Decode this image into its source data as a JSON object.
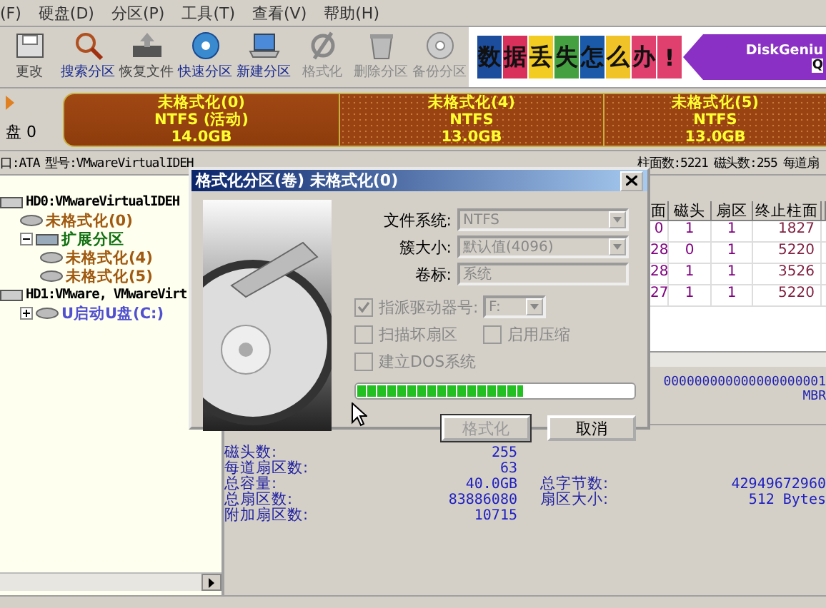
{
  "menu": [
    "(F)",
    "硬盘(D)",
    "分区(P)",
    "工具(T)",
    "查看(V)",
    "帮助(H)"
  ],
  "toolbar": {
    "buttons": [
      {
        "label": "更改",
        "disabled": false,
        "emphasis": false
      },
      {
        "label": "搜索分区",
        "disabled": false,
        "emphasis": true
      },
      {
        "label": "恢复文件",
        "disabled": false,
        "emphasis": false
      },
      {
        "label": "快速分区",
        "disabled": false,
        "emphasis": true
      },
      {
        "label": "新建分区",
        "disabled": false,
        "emphasis": true
      },
      {
        "label": "格式化",
        "disabled": true,
        "emphasis": false
      },
      {
        "label": "删除分区",
        "disabled": true,
        "emphasis": false
      },
      {
        "label": "备份分区",
        "disabled": true,
        "emphasis": false
      }
    ],
    "banner": {
      "chars": [
        {
          "text": "数",
          "color": "#1c4c9c"
        },
        {
          "text": "据",
          "color": "#d8305a"
        },
        {
          "text": "丢",
          "color": "#f2cc20"
        },
        {
          "text": "失",
          "color": "#44a040"
        },
        {
          "text": "怎",
          "color": "#1a5aa8"
        },
        {
          "text": "么",
          "color": "#f0c428"
        },
        {
          "text": "办",
          "color": "#e0406e"
        },
        {
          "text": "!",
          "color": "#e0406e"
        }
      ],
      "brand": "DiskGeniu",
      "tail": "Q"
    }
  },
  "disk_map": {
    "label": "盘 0",
    "partitions": [
      {
        "name": "未格式化(0)",
        "fs": "NTFS (活动)",
        "size": "14.0GB",
        "selected": true
      },
      {
        "name": "未格式化(4)",
        "fs": "NTFS",
        "size": "13.0GB",
        "selected": false
      },
      {
        "name": "未格式化(5)",
        "fs": "NTFS",
        "size": "13.0GB",
        "selected": false
      }
    ]
  },
  "disk_info": {
    "left": [
      "口:ATA",
      "型号:VMwareVirtualIDEH"
    ],
    "right": [
      "柱面数:5221",
      "磁头数:255",
      "每道扇"
    ]
  },
  "tree": [
    {
      "label": "HD0:VMwareVirtualIDEH",
      "kind": "disk",
      "children": [
        {
          "label": "未格式化(0)",
          "kind": "partition"
        },
        {
          "label": "扩展分区",
          "kind": "extended",
          "expanded": true,
          "children": [
            {
              "label": "未格式化(4)",
              "kind": "partition"
            },
            {
              "label": "未格式化(5)",
              "kind": "partition"
            }
          ]
        }
      ]
    },
    {
      "label": "HD1:VMware, VMwareVirt",
      "kind": "disk",
      "children": [
        {
          "label": "U启动U盘(C:)",
          "kind": "removable",
          "expanded": false
        }
      ]
    }
  ],
  "table": {
    "columns": [
      "面",
      "磁头",
      "扇区",
      "终止柱面"
    ],
    "rows": [
      [
        "0",
        "1",
        "1",
        "1827"
      ],
      [
        "28",
        "0",
        "1",
        "5220"
      ],
      [
        "28",
        "1",
        "1",
        "3526"
      ],
      [
        "27",
        "1",
        "1",
        "5220"
      ]
    ]
  },
  "hex": {
    "line": "000000000000000000001",
    "tag": "MBR"
  },
  "details": [
    {
      "label": "磁头数:",
      "value": "255"
    },
    {
      "label": "每道扇区数:",
      "value": "63"
    },
    {
      "label": "总容量:",
      "value": "40.0GB",
      "label2": "总字节数:",
      "value2": "42949672960"
    },
    {
      "label": "总扇区数:",
      "value": "83886080",
      "label2": "扇区大小:",
      "value2": "512 Bytes"
    },
    {
      "label": "附加扇区数:",
      "value": "10715"
    }
  ],
  "dialog": {
    "title": "格式化分区(卷) 未格式化(0)",
    "fields": [
      {
        "label": "文件系统:",
        "value": "NTFS",
        "kind": "select"
      },
      {
        "label": "簇大小:",
        "value": "默认值(4096)",
        "kind": "select"
      },
      {
        "label": "卷标:",
        "value": "系统",
        "kind": "input"
      }
    ],
    "assign": {
      "label": "指派驱动器号:",
      "checked": true,
      "drive": "F:"
    },
    "checks": [
      {
        "label": "扫描坏扇区",
        "checked": false
      },
      {
        "label": "启用压缩",
        "checked": false
      },
      {
        "label": "建立DOS系统",
        "checked": false
      }
    ],
    "progress": {
      "level": 0.6
    },
    "buttons": [
      {
        "label": "格式化",
        "disabled": true
      },
      {
        "label": "取消",
        "disabled": false
      }
    ]
  }
}
